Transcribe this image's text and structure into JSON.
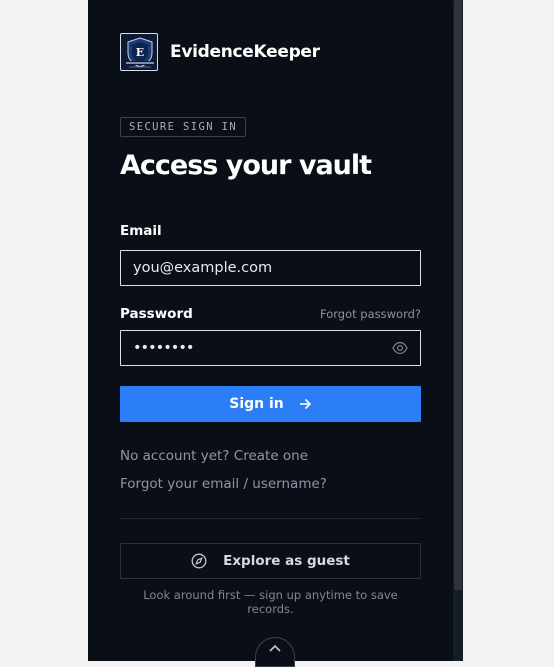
{
  "brand": {
    "name": "EvidenceKeeper"
  },
  "auth": {
    "eyebrow": "SECURE SIGN IN",
    "title": "Access your vault",
    "email_label": "Email",
    "email_value": "you@example.com",
    "password_label": "Password",
    "forgot_password": "Forgot password?",
    "password_value": "••••••••",
    "signin_label": "Sign in",
    "create_account": "No account yet? Create one",
    "forgot_email": "Forgot your email / username?",
    "guest_label": "Explore as guest",
    "guest_note": "Look around first — sign up anytime to save records."
  },
  "colors": {
    "panel": "#0a0f17",
    "accent": "#2b7ef6"
  },
  "icons": {
    "logo": "shield-logo-icon",
    "eye": "eye-icon",
    "arrow": "arrow-right-icon",
    "compass": "compass-icon",
    "chevron": "chevron-up-icon"
  }
}
